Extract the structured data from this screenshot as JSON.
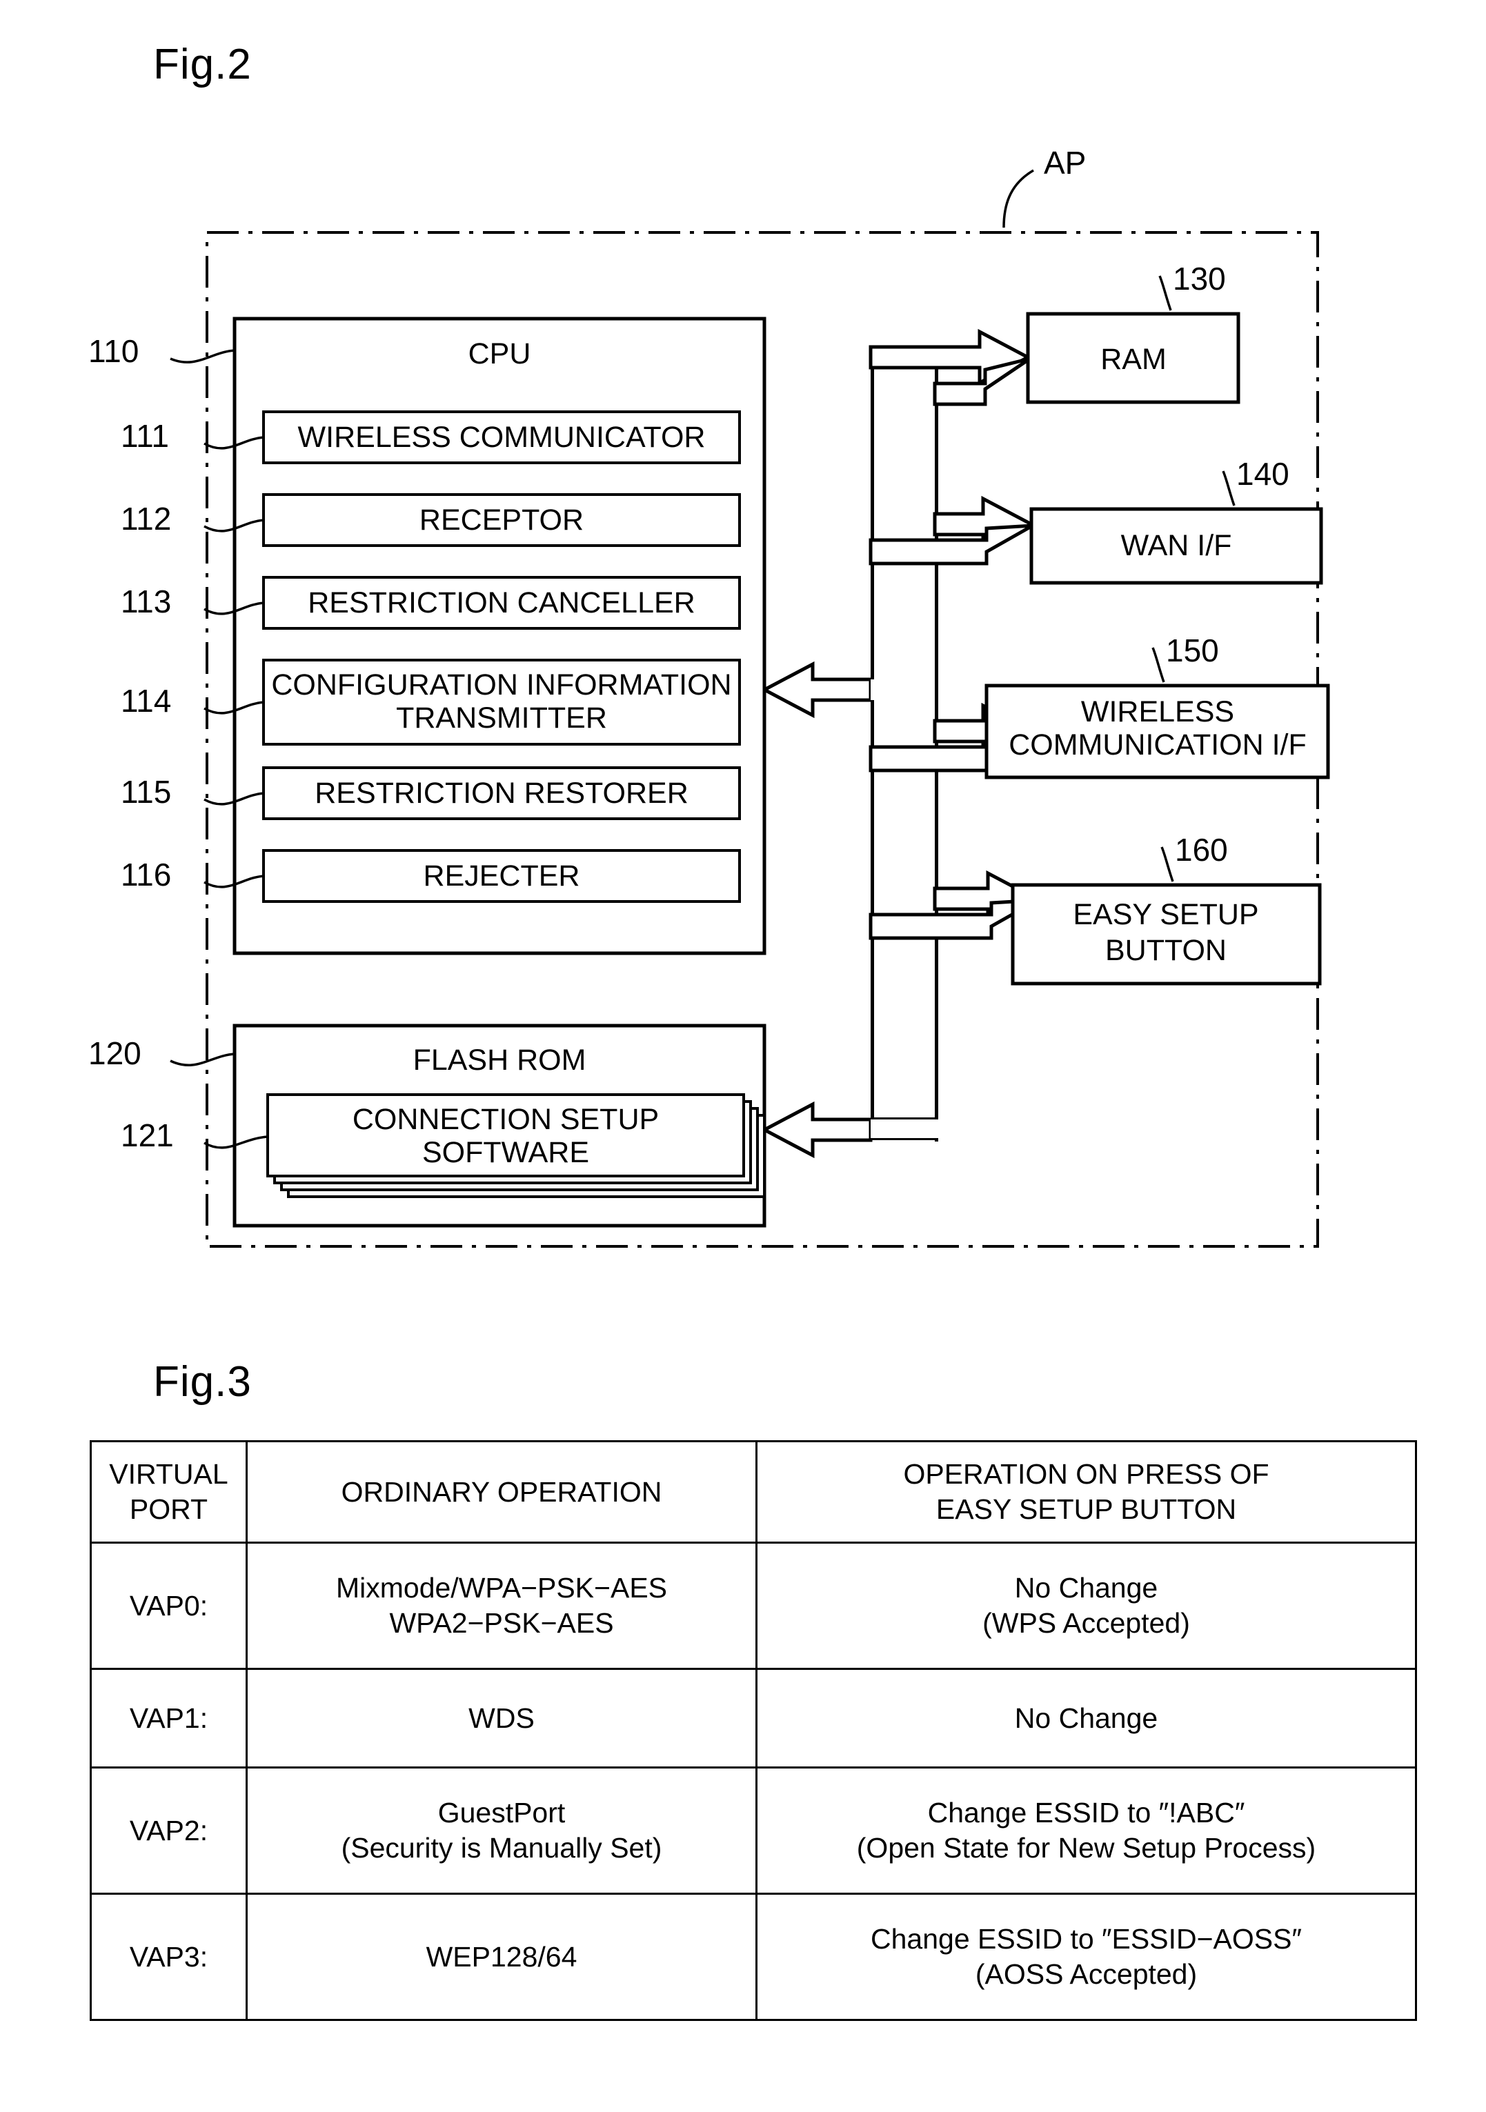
{
  "figure2": {
    "label": "Fig.2",
    "device_label": "AP",
    "blocks": {
      "cpu": {
        "ref": "110",
        "title": "CPU"
      },
      "flash": {
        "ref": "120",
        "title": "FLASH ROM"
      },
      "connection_software": {
        "ref": "121",
        "title": "CONNECTION SETUP SOFTWARE",
        "line1": "CONNECTION SETUP",
        "line2": "SOFTWARE"
      },
      "ram": {
        "ref": "130",
        "title": "RAM"
      },
      "wan": {
        "ref": "140",
        "title": "WAN I/F"
      },
      "wireless_if": {
        "ref": "150",
        "title": "WIRELESS COMMUNICATION I/F",
        "line1": "WIRELESS",
        "line2": "COMMUNICATION I/F"
      },
      "easy_setup": {
        "ref": "160",
        "title": "EASY SETUP BUTTON",
        "line1": "EASY SETUP",
        "line2": "BUTTON"
      }
    },
    "cpu_modules": [
      {
        "ref": "111",
        "title": "WIRELESS COMMUNICATOR",
        "line1": "WIRELESS COMMUNICATOR",
        "line2": ""
      },
      {
        "ref": "112",
        "title": "RECEPTOR",
        "line1": "RECEPTOR",
        "line2": ""
      },
      {
        "ref": "113",
        "title": "RESTRICTION CANCELLER",
        "line1": "RESTRICTION CANCELLER",
        "line2": ""
      },
      {
        "ref": "114",
        "title": "CONFIGURATION INFORMATION TRANSMITTER",
        "line1": "CONFIGURATION INFORMATION",
        "line2": "TRANSMITTER"
      },
      {
        "ref": "115",
        "title": "RESTRICTION RESTORER",
        "line1": "RESTRICTION RESTORER",
        "line2": ""
      },
      {
        "ref": "116",
        "title": "REJECTER",
        "line1": "REJECTER",
        "line2": ""
      }
    ]
  },
  "figure3": {
    "label": "Fig.3",
    "table": {
      "headers": [
        {
          "line1": "VIRTUAL",
          "line2": "PORT"
        },
        {
          "line1": "ORDINARY OPERATION",
          "line2": ""
        },
        {
          "line1": "OPERATION ON PRESS OF",
          "line2": "EASY SETUP BUTTON"
        }
      ],
      "rows": [
        {
          "port": "VAP0:",
          "ordinary_1": "Mixmode/WPA−PSK−AES",
          "ordinary_2": "WPA2−PSK−AES",
          "press_1": "No Change",
          "press_2": "(WPS Accepted)"
        },
        {
          "port": "VAP1:",
          "ordinary_1": "WDS",
          "ordinary_2": "",
          "press_1": "No Change",
          "press_2": ""
        },
        {
          "port": "VAP2:",
          "ordinary_1": "GuestPort",
          "ordinary_2": "(Security is Manually Set)",
          "press_1": "Change ESSID to ″!ABC″",
          "press_2": "(Open State for New Setup Process)"
        },
        {
          "port": "VAP3:",
          "ordinary_1": "WEP128/64",
          "ordinary_2": "",
          "press_1": "Change ESSID to ″ESSID−AOSS″",
          "press_2": "(AOSS Accepted)"
        }
      ]
    }
  },
  "colors": {
    "ink": "#000000",
    "paper": "#ffffff"
  }
}
